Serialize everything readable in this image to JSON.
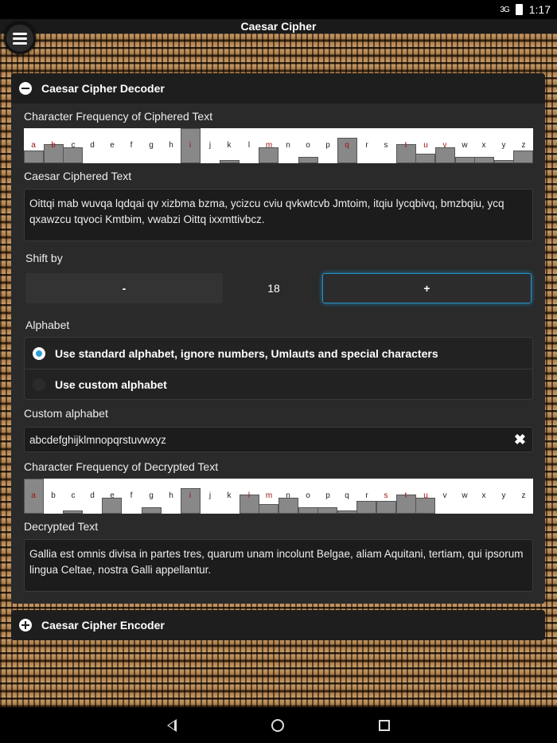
{
  "status": {
    "signal": "3G",
    "time": "1:17"
  },
  "app": {
    "title": "Caesar Cipher"
  },
  "decoder": {
    "title": "Caesar Cipher Decoder",
    "cipher_freq_label": "Character Frequency of Ciphered Text",
    "cipher_text_label": "Caesar Ciphered Text",
    "cipher_text": "Oittqi mab wuvqa lqdqai qv xizbma bzma, ycizcu cviu qvkwtcvb Jmtoim, itqiu lycqbivq, bmzbqiu, ycq qxawzcu tqvoci Kmtbim, vwabzi Oittq ixxmttivbcz.",
    "shift_label": "Shift by",
    "minus_label": "-",
    "shift_value": "18",
    "plus_label": "+",
    "alphabet_label": "Alphabet",
    "option_standard": "Use standard alphabet, ignore numbers, Umlauts and special characters",
    "option_custom": "Use custom alphabet",
    "custom_alphabet_label": "Custom alphabet",
    "custom_alphabet_value": "abcdefghijklmnopqrstuvwxyz",
    "decrypted_freq_label": "Character Frequency of Decrypted Text",
    "decrypted_text_label": "Decrypted Text",
    "decrypted_text": "Gallia est omnis divisa in partes tres, quarum unam incolunt Belgae, aliam Aquitani, tertiam, qui ipsorum lingua Celtae, nostra Galli appellantur."
  },
  "encoder": {
    "title": "Caesar Cipher Encoder"
  },
  "chart_data": [
    {
      "type": "bar",
      "categories": [
        "a",
        "b",
        "c",
        "d",
        "e",
        "f",
        "g",
        "h",
        "i",
        "j",
        "k",
        "l",
        "m",
        "n",
        "o",
        "p",
        "q",
        "r",
        "s",
        "t",
        "u",
        "v",
        "w",
        "x",
        "y",
        "z"
      ],
      "values": [
        4,
        6,
        5,
        0,
        0,
        0,
        0,
        0,
        11,
        0,
        1,
        0,
        5,
        0,
        2,
        0,
        8,
        0,
        0,
        6,
        3,
        5,
        2,
        2,
        1,
        4
      ],
      "highlighted": [
        "a",
        "b",
        "i",
        "m",
        "q",
        "t",
        "u",
        "v"
      ],
      "ylim": [
        0,
        11
      ]
    },
    {
      "type": "bar",
      "categories": [
        "a",
        "b",
        "c",
        "d",
        "e",
        "f",
        "g",
        "h",
        "i",
        "j",
        "k",
        "l",
        "m",
        "n",
        "o",
        "p",
        "q",
        "r",
        "s",
        "t",
        "u",
        "v",
        "w",
        "x",
        "y",
        "z"
      ],
      "values": [
        11,
        0,
        1,
        0,
        5,
        0,
        2,
        0,
        8,
        0,
        0,
        6,
        3,
        5,
        2,
        2,
        1,
        4,
        4,
        6,
        5,
        0,
        0,
        0,
        0,
        0
      ],
      "highlighted": [
        "a",
        "i",
        "l",
        "m",
        "s",
        "t",
        "u"
      ],
      "ylim": [
        0,
        11
      ]
    }
  ],
  "colors": {
    "accent": "#2aa0d8",
    "highlight_letter": "#a01010",
    "bar": "#888888"
  }
}
